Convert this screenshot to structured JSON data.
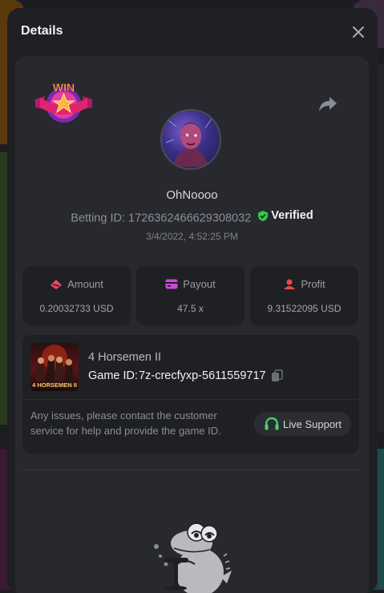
{
  "modal": {
    "title": "Details"
  },
  "bet": {
    "username": "OhNoooo",
    "betting_id_label": "Betting ID:",
    "betting_id": "1726362466629308032",
    "verified_label": "Verified",
    "time": "3/4/2022, 4:52:25 PM",
    "badge_text": "WIN"
  },
  "stats": [
    {
      "label": "Amount",
      "value": "0.20032733 USD",
      "icon": "amount-icon",
      "color": "#e94b65"
    },
    {
      "label": "Payout",
      "value": "47.5 x",
      "icon": "payout-icon",
      "color": "#c84bd6"
    },
    {
      "label": "Profit",
      "value": "9.31522095 USD",
      "icon": "profit-icon",
      "color": "#e94b4b"
    }
  ],
  "game": {
    "name": "4 Horsemen II",
    "id_label": "Game ID:",
    "id": "7z-crecfyxp-5611559717",
    "thumb_label": "4 HORSEMEN II"
  },
  "support": {
    "text": "Any issues, please contact the customer service for help and provide the game ID.",
    "button_label": "Live Support"
  },
  "colors": {
    "verified": "#2ecc40",
    "support_icon": "#3fd96b"
  }
}
